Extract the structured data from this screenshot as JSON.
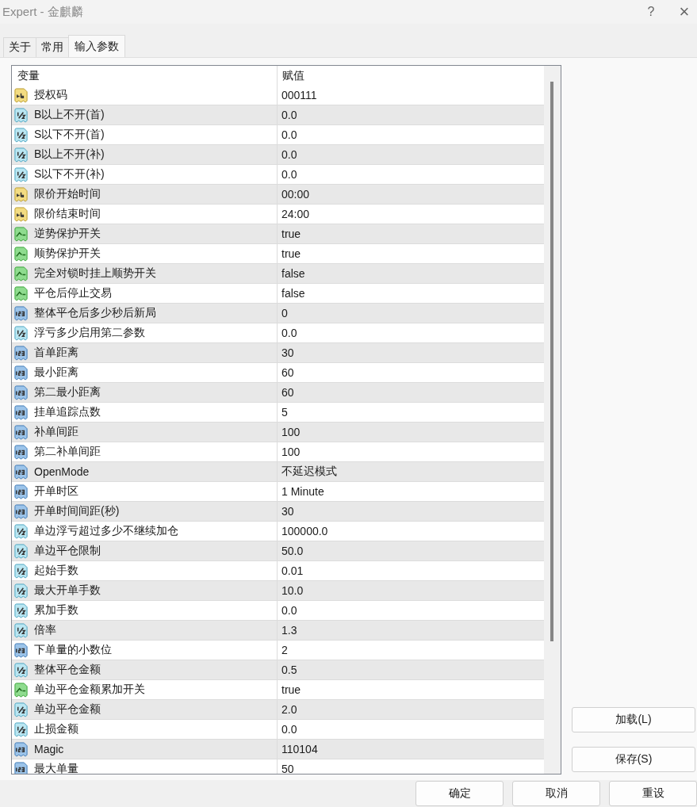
{
  "window": {
    "title": "Expert - 金麒麟",
    "help": "?",
    "close": "×"
  },
  "tabs": [
    {
      "label": "关于",
      "selected": false
    },
    {
      "label": "常用",
      "selected": false
    },
    {
      "label": "输入参数",
      "selected": true
    }
  ],
  "table": {
    "columns": [
      "变量",
      "赋值"
    ],
    "rows": [
      {
        "kind": "string",
        "name": "授权码",
        "value": "000111"
      },
      {
        "kind": "double",
        "name": "B以上不开(首)",
        "value": "0.0"
      },
      {
        "kind": "double",
        "name": "S以下不开(首)",
        "value": "0.0"
      },
      {
        "kind": "double",
        "name": "B以上不开(补)",
        "value": "0.0"
      },
      {
        "kind": "double",
        "name": "S以下不开(补)",
        "value": "0.0"
      },
      {
        "kind": "string",
        "name": "限价开始时间",
        "value": "00:00"
      },
      {
        "kind": "string",
        "name": "限价结束时间",
        "value": "24:00"
      },
      {
        "kind": "bool",
        "name": "逆势保护开关",
        "value": "true"
      },
      {
        "kind": "bool",
        "name": "顺势保护开关",
        "value": "true"
      },
      {
        "kind": "bool",
        "name": "完全对锁时挂上顺势开关",
        "value": "false"
      },
      {
        "kind": "bool",
        "name": "平仓后停止交易",
        "value": "false"
      },
      {
        "kind": "int",
        "name": "整体平仓后多少秒后新局",
        "value": "0"
      },
      {
        "kind": "double",
        "name": "浮亏多少启用第二参数",
        "value": "0.0"
      },
      {
        "kind": "int",
        "name": "首单距离",
        "value": "30"
      },
      {
        "kind": "int",
        "name": "最小距离",
        "value": "60"
      },
      {
        "kind": "int",
        "name": "第二最小距离",
        "value": "60"
      },
      {
        "kind": "int",
        "name": "挂单追踪点数",
        "value": "5"
      },
      {
        "kind": "int",
        "name": "补单间距",
        "value": "100"
      },
      {
        "kind": "int",
        "name": "第二补单间距",
        "value": "100"
      },
      {
        "kind": "int",
        "name": "OpenMode",
        "value": "不延迟模式"
      },
      {
        "kind": "int",
        "name": "开单时区",
        "value": "1 Minute"
      },
      {
        "kind": "int",
        "name": "开单时间间距(秒)",
        "value": "30"
      },
      {
        "kind": "double",
        "name": "单边浮亏超过多少不继续加仓",
        "value": "100000.0"
      },
      {
        "kind": "double",
        "name": "单边平仓限制",
        "value": "50.0"
      },
      {
        "kind": "double",
        "name": "起始手数",
        "value": "0.01"
      },
      {
        "kind": "double",
        "name": "最大开单手数",
        "value": "10.0"
      },
      {
        "kind": "double",
        "name": "累加手数",
        "value": "0.0"
      },
      {
        "kind": "double",
        "name": "倍率",
        "value": "1.3"
      },
      {
        "kind": "int",
        "name": "下单量的小数位",
        "value": "2"
      },
      {
        "kind": "double",
        "name": "整体平仓金额",
        "value": "0.5"
      },
      {
        "kind": "bool",
        "name": "单边平仓金额累加开关",
        "value": "true"
      },
      {
        "kind": "double",
        "name": "单边平仓金额",
        "value": "2.0"
      },
      {
        "kind": "double",
        "name": "止损金额",
        "value": "0.0"
      },
      {
        "kind": "int",
        "name": "Magic",
        "value": "110104"
      },
      {
        "kind": "int",
        "name": "最大单量",
        "value": "50"
      }
    ]
  },
  "side_buttons": [
    "加载(L)",
    "保存(S)"
  ],
  "buttons": [
    "确定",
    "取消",
    "重设"
  ]
}
